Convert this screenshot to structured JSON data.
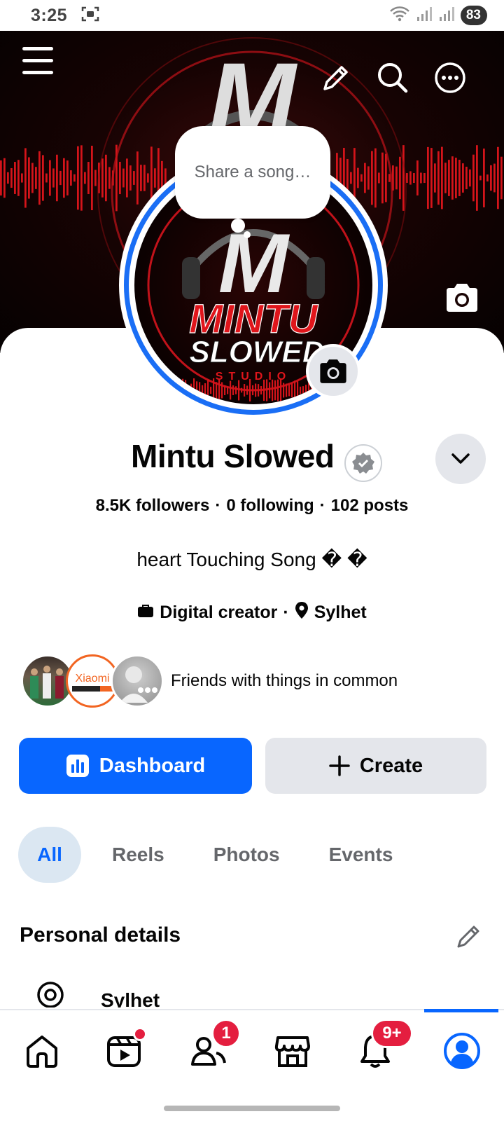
{
  "status_bar": {
    "time": "3:25",
    "battery": "83"
  },
  "cover": {
    "buttons": [
      "menu-icon",
      "pencil-icon",
      "search-icon",
      "more-icon",
      "camera-icon"
    ]
  },
  "profile_picture": {
    "logo_text": "MINTU SLOWED STUDIO"
  },
  "song_bubble": {
    "placeholder": "Share a song…"
  },
  "profile": {
    "name": "Mintu Slowed",
    "stats": {
      "followers": "8.5K followers",
      "following": "0 following",
      "posts": "102 posts",
      "separator": "·"
    },
    "bio": "heart Touching Song � �",
    "category": "Digital creator",
    "meta_separator": "·",
    "location": "Sylhet",
    "friends_text": "Friends with things in common",
    "friend_avatars": [
      "group-photo",
      "Xiaomi",
      "person-photo"
    ]
  },
  "actions": {
    "dashboard_label": "Dashboard",
    "create_label": "Create"
  },
  "tabs": [
    {
      "label": "All",
      "active": true
    },
    {
      "label": "Reels",
      "active": false
    },
    {
      "label": "Photos",
      "active": false
    },
    {
      "label": "Events",
      "active": false
    }
  ],
  "personal_details": {
    "title": "Personal details",
    "items": [
      {
        "icon": "location-icon",
        "text": "Sylhet"
      }
    ]
  },
  "bottom_nav": [
    {
      "name": "home",
      "icon": "home-icon"
    },
    {
      "name": "video",
      "icon": "video-icon",
      "dot": true
    },
    {
      "name": "friends",
      "icon": "friends-icon",
      "badge": "1"
    },
    {
      "name": "marketplace",
      "icon": "marketplace-icon"
    },
    {
      "name": "notifications",
      "icon": "bell-icon",
      "badge": "9+"
    },
    {
      "name": "profile",
      "icon": "profile-icon",
      "active": true
    }
  ],
  "colors": {
    "accent": "#0866ff",
    "badge": "#e41e3f",
    "cover_red": "#e0151b",
    "chip_active_bg": "#dbe7f2"
  }
}
